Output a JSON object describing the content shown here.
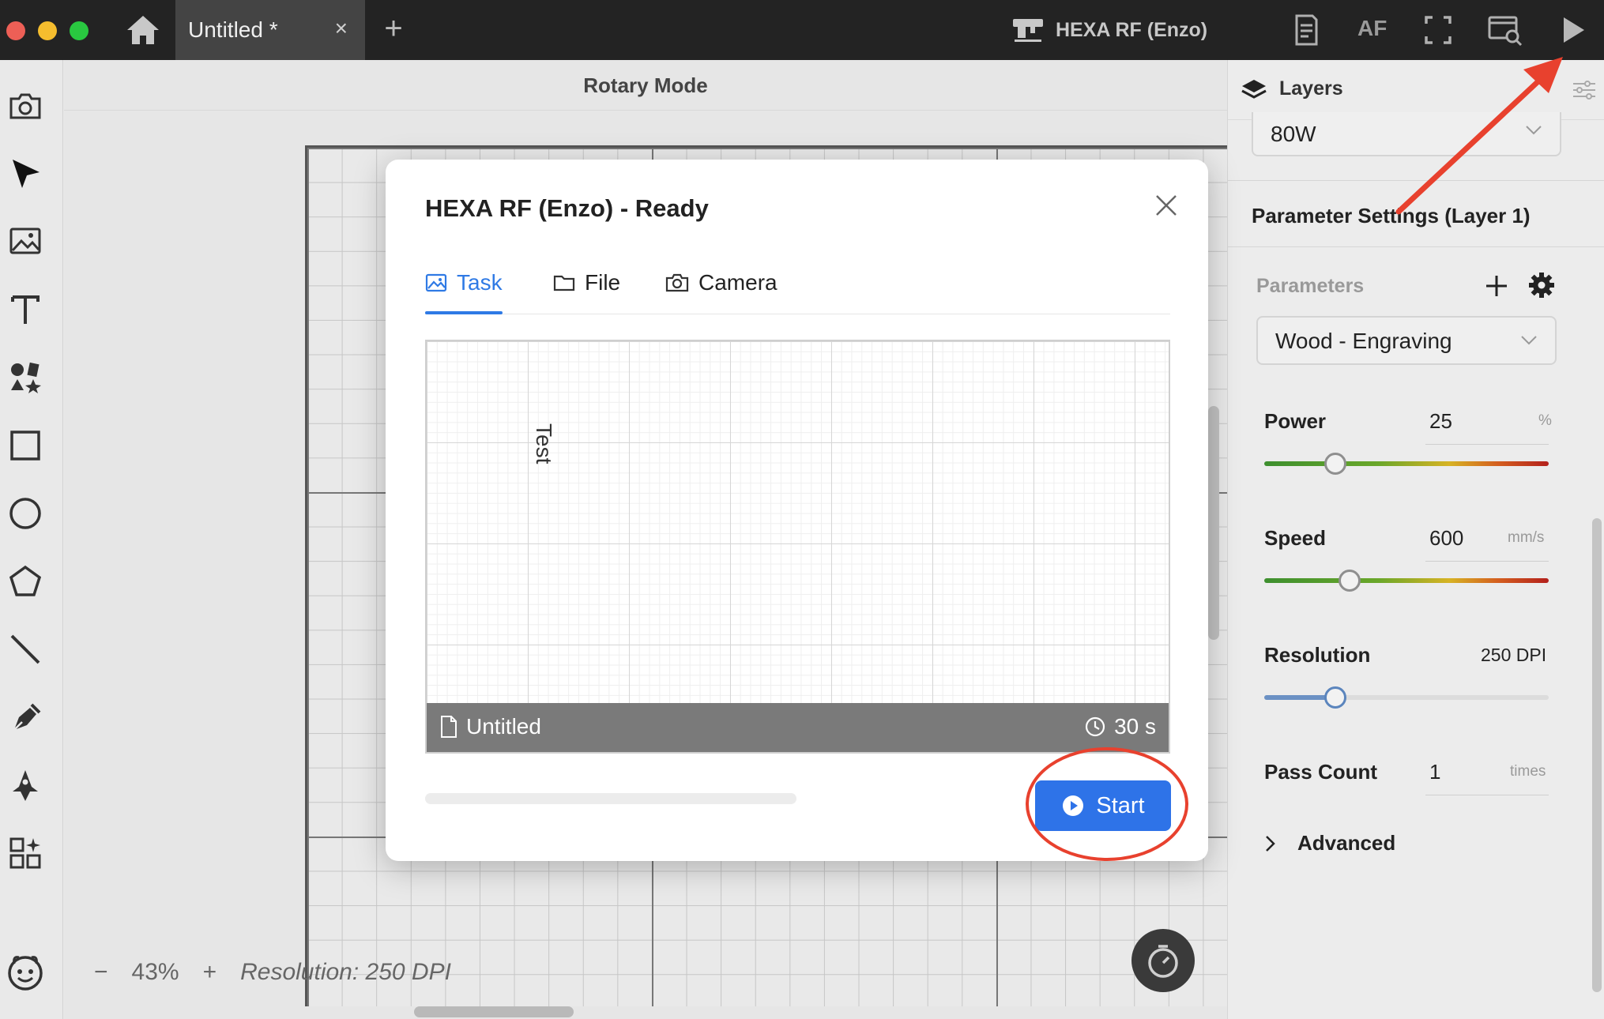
{
  "window": {
    "tab_title": "Untitled *",
    "tab_close": "×",
    "new_tab": "+",
    "machine_name": "HEXA RF (Enzo)",
    "af_label": "AF"
  },
  "canvas": {
    "mode_title": "Rotary Mode",
    "zoom_minus": "−",
    "zoom_level": "43%",
    "zoom_plus": "+",
    "resolution": "Resolution: 250 DPI"
  },
  "panel": {
    "layers_title": "Layers",
    "laser_power_select": "80W",
    "param_settings_title": "Parameter Settings (Layer 1)",
    "parameters_label": "Parameters",
    "preset_select": "Wood - Engraving",
    "power": {
      "label": "Power",
      "value": "25",
      "unit": "%",
      "fraction": 0.25
    },
    "speed": {
      "label": "Speed",
      "value": "600",
      "unit": "mm/s",
      "fraction": 0.3
    },
    "resolution": {
      "label": "Resolution",
      "value": "250 DPI",
      "fraction": 0.25
    },
    "pass_count": {
      "label": "Pass Count",
      "value": "1",
      "unit": "times"
    },
    "advanced_label": "Advanced"
  },
  "modal": {
    "title": "HEXA RF (Enzo) - Ready",
    "tabs": [
      {
        "label": "Task",
        "icon": "image-icon",
        "active": true
      },
      {
        "label": "File",
        "icon": "folder-icon",
        "active": false
      },
      {
        "label": "Camera",
        "icon": "camera-icon",
        "active": false
      }
    ],
    "preview_text": "Test",
    "file_name": "Untitled",
    "estimated_time": "30 s",
    "progress": 0,
    "start_label": "Start"
  },
  "colors": {
    "accent": "#2e73e8",
    "annotation": "#e8412e"
  }
}
